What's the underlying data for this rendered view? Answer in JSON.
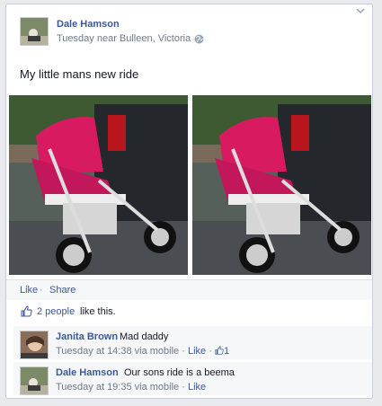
{
  "post": {
    "author": "Dale Hamson",
    "date": "Tuesday near Bulleen, Victoria",
    "text": "My little mans new ride",
    "icons": {
      "privacy": "globe-icon",
      "menu": "chevron-down-icon"
    }
  },
  "actions": {
    "like": "Like",
    "separator": " · ",
    "share": "Share"
  },
  "likes": {
    "count_link": "2 people",
    "suffix": "like this."
  },
  "comments": [
    {
      "author": "Janita Brown",
      "text": "Mad daddy",
      "meta": "Tuesday at 14:38 via mobile",
      "sep": " · ",
      "like": "Like",
      "sep2": " · ",
      "like_count": "1"
    },
    {
      "author": "Dale Hamson",
      "text": "Our sons ride is a beema",
      "meta": "Tuesday at 19:35 via mobile",
      "sep": " · ",
      "like": "Like"
    }
  ],
  "colors": {
    "link": "#3b5998",
    "stroller_pink": "#d81b60",
    "meta_gray": "#6d7b8a"
  }
}
